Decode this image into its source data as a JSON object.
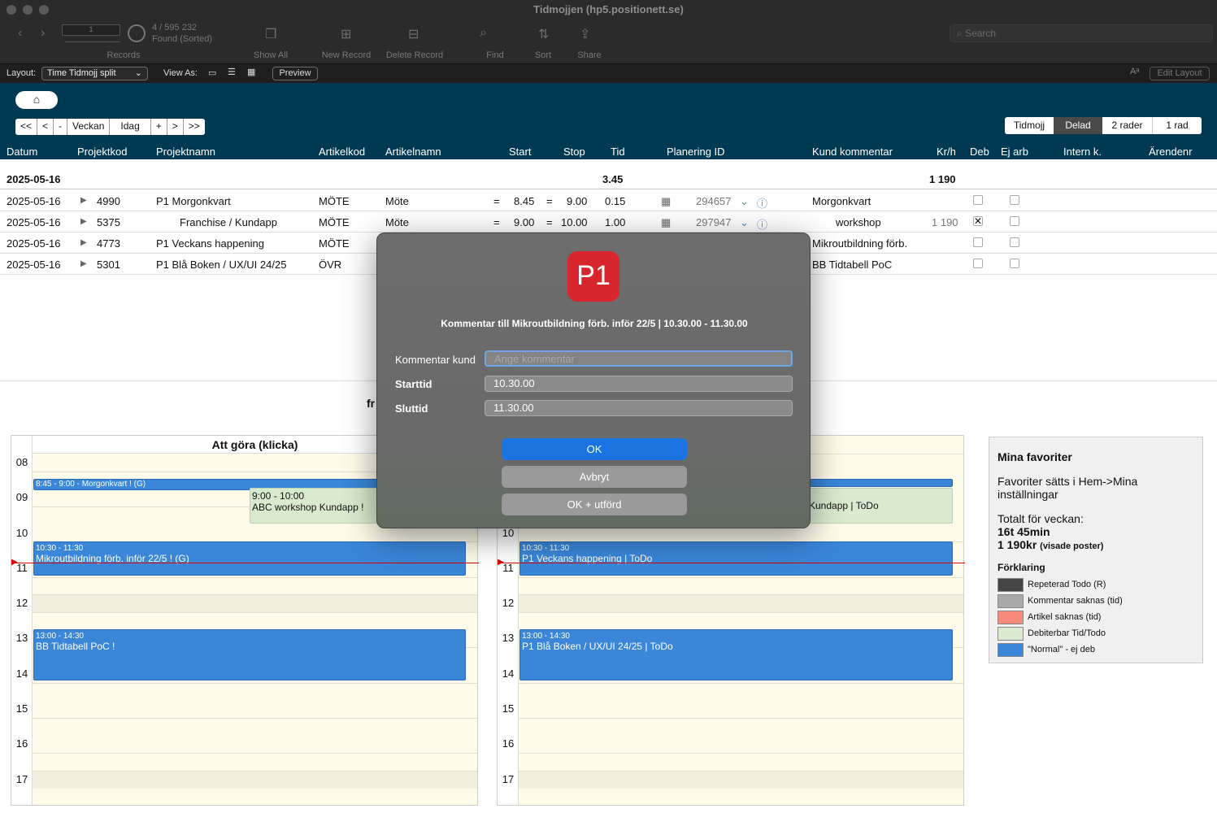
{
  "window": {
    "title": "Tidmojjen (hp5.positionett.se)"
  },
  "toolbar": {
    "records_count": "4 / 595 232",
    "records_status": "Found (Sorted)",
    "records_label": "Records",
    "record_input": "1",
    "show_all": "Show All",
    "new_record": "New Record",
    "delete_record": "Delete Record",
    "find": "Find",
    "sort": "Sort",
    "share": "Share",
    "search_placeholder": "Search"
  },
  "layoutbar": {
    "layout_label": "Layout:",
    "layout_value": "Time Tidmojj split",
    "view_as": "View As:",
    "preview": "Preview",
    "edit_layout": "Edit Layout"
  },
  "nav": {
    "buttons": [
      "<<",
      "<",
      "-",
      "Veckan",
      "Idag",
      "+",
      ">",
      ">>"
    ]
  },
  "viewseg": [
    "Tidmojj",
    "Delad",
    "2 rader",
    "1 rad"
  ],
  "columns": {
    "datum": "Datum",
    "projektkod": "Projektkod",
    "projektnamn": "Projektnamn",
    "artikelkod": "Artikelkod",
    "artikelnamn": "Artikelnamn",
    "start": "Start",
    "stop": "Stop",
    "tid": "Tid",
    "planering": "Planering ID",
    "kund": "Kund kommentar",
    "krh": "Kr/h",
    "deb": "Deb",
    "ejarb": "Ej arb",
    "intern": "Intern k.",
    "arendenr": "Ärendenr"
  },
  "summary": {
    "date": "2025-05-16",
    "tid": "3.45",
    "kr": "1 190"
  },
  "rows": [
    {
      "datum": "2025-05-16",
      "kod": "4990",
      "namn": "P1 Morgonkvart",
      "artkod": "MÖTE",
      "artnamn": "Möte",
      "eq1": "=",
      "start": "8.45",
      "eq2": "=",
      "stop": "9.00",
      "tid": "0.15",
      "plan": "294657",
      "kund": "Morgonkvart",
      "kr": "",
      "deb": false
    },
    {
      "datum": "2025-05-16",
      "kod": "5375",
      "namn": "Franchise / Kundapp",
      "artkod": "MÖTE",
      "artnamn": "Möte",
      "eq1": "=",
      "start": "9.00",
      "eq2": "=",
      "stop": "10.00",
      "tid": "1.00",
      "plan": "297947",
      "kund": "workshop",
      "kr": "1 190",
      "deb": true
    },
    {
      "datum": "2025-05-16",
      "kod": "4773",
      "namn": "P1 Veckans happening",
      "artkod": "MÖTE",
      "kund": "Mikroutbildning förb.",
      "deb": false
    },
    {
      "datum": "2025-05-16",
      "kod": "5301",
      "namn": "P1 Blå Boken / UX/UI 24/25",
      "artkod": "ÖVR",
      "kund": "BB Tidtabell PoC",
      "deb": false
    }
  ],
  "calendar": {
    "left_title": "Att göra (klicka)",
    "partial_label": "fr",
    "hours": [
      "08",
      "09",
      "10",
      "11",
      "12",
      "13",
      "14",
      "15",
      "16",
      "17"
    ],
    "left_events": [
      {
        "time": "8:45 - 9:00 - Morgonkvart ! (G)",
        "title": ""
      },
      {
        "time": "9:00 - 10:00",
        "title": "ABC workshop Kundapp !"
      },
      {
        "time": "10:30 - 11:30",
        "title": "Mikroutbildning förb. inför 22/5 ! (G)"
      },
      {
        "time": "13:00 - 14:30",
        "title": "BB Tidtabell PoC !"
      }
    ],
    "right_events": [
      {
        "time": "",
        "title": "Kundapp | ToDo"
      },
      {
        "time": "10:30 - 11:30",
        "title": "P1 Veckans happening | ToDo"
      },
      {
        "time": "13:00 - 14:30",
        "title": "P1 Blå Boken / UX/UI 24/25 | ToDo"
      }
    ]
  },
  "favorites": {
    "title": "Mina favoriter",
    "text": "Favoriter sätts i Hem->Mina inställningar",
    "total_label": "Totalt för veckan:",
    "total_time": "16t 45min",
    "total_kr": "1 190kr",
    "total_kr_note": "(visade poster)",
    "legend_title": "Förklaring",
    "legend": [
      {
        "label": "Repeterad Todo (R)",
        "color": "#454545"
      },
      {
        "label": "Kommentar saknas (tid)",
        "color": "#a9a9a9"
      },
      {
        "label": "Artikel saknas (tid)",
        "color": "#f78a7a"
      },
      {
        "label": "Debiterbar Tid/Todo",
        "color": "#d8ebcf"
      },
      {
        "label": "\"Normal\" - ej deb",
        "color": "#3a86d9"
      }
    ]
  },
  "dialog": {
    "logo": "P1",
    "title": "Kommentar till Mikroutbildning förb. inför 22/5 | 10.30.00 - 11.30.00",
    "kommentar_label": "Kommentar kund",
    "kommentar_placeholder": "Ange kommentar",
    "starttid_label": "Starttid",
    "starttid_value": "10.30.00",
    "sluttid_label": "Sluttid",
    "sluttid_value": "11.30.00",
    "ok": "OK",
    "avbryt": "Avbryt",
    "ok_utford": "OK + utförd"
  }
}
